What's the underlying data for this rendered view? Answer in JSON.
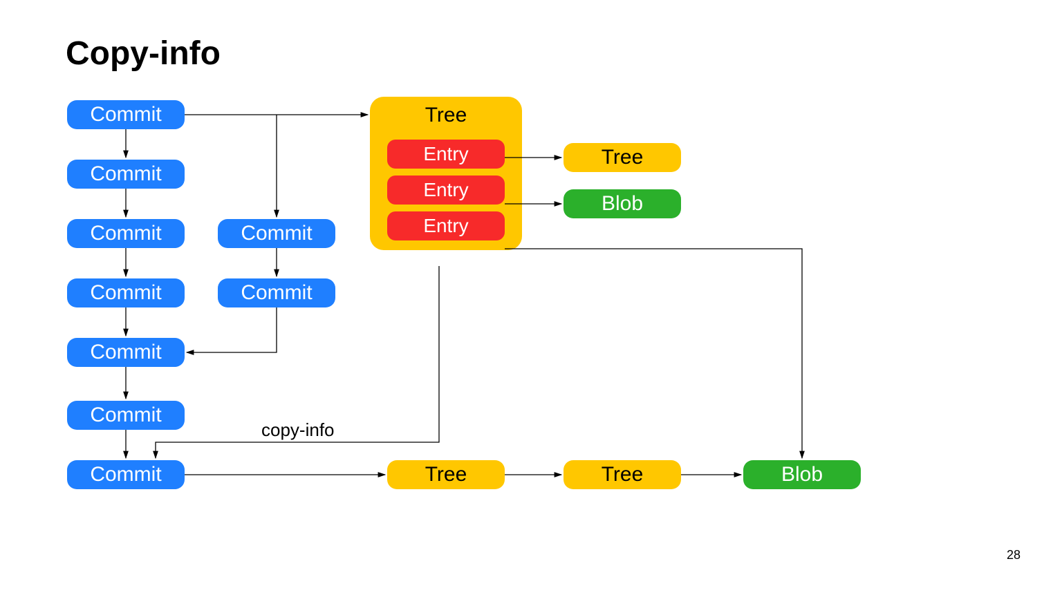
{
  "title": "Copy-info",
  "pageNumber": "28",
  "copyInfoLabel": "copy-info",
  "commits": {
    "c1": "Commit",
    "c2": "Commit",
    "c3": "Commit",
    "c4": "Commit",
    "c5": "Commit",
    "c6": "Commit",
    "c7": "Commit",
    "cb1": "Commit",
    "cb2": "Commit"
  },
  "treeBig": {
    "title": "Tree",
    "entry1": "Entry",
    "entry2": "Entry",
    "entry3": "Entry"
  },
  "treeSmall1": "Tree",
  "blob1": "Blob",
  "treeBottom1": "Tree",
  "treeBottom2": "Tree",
  "blob2": "Blob"
}
